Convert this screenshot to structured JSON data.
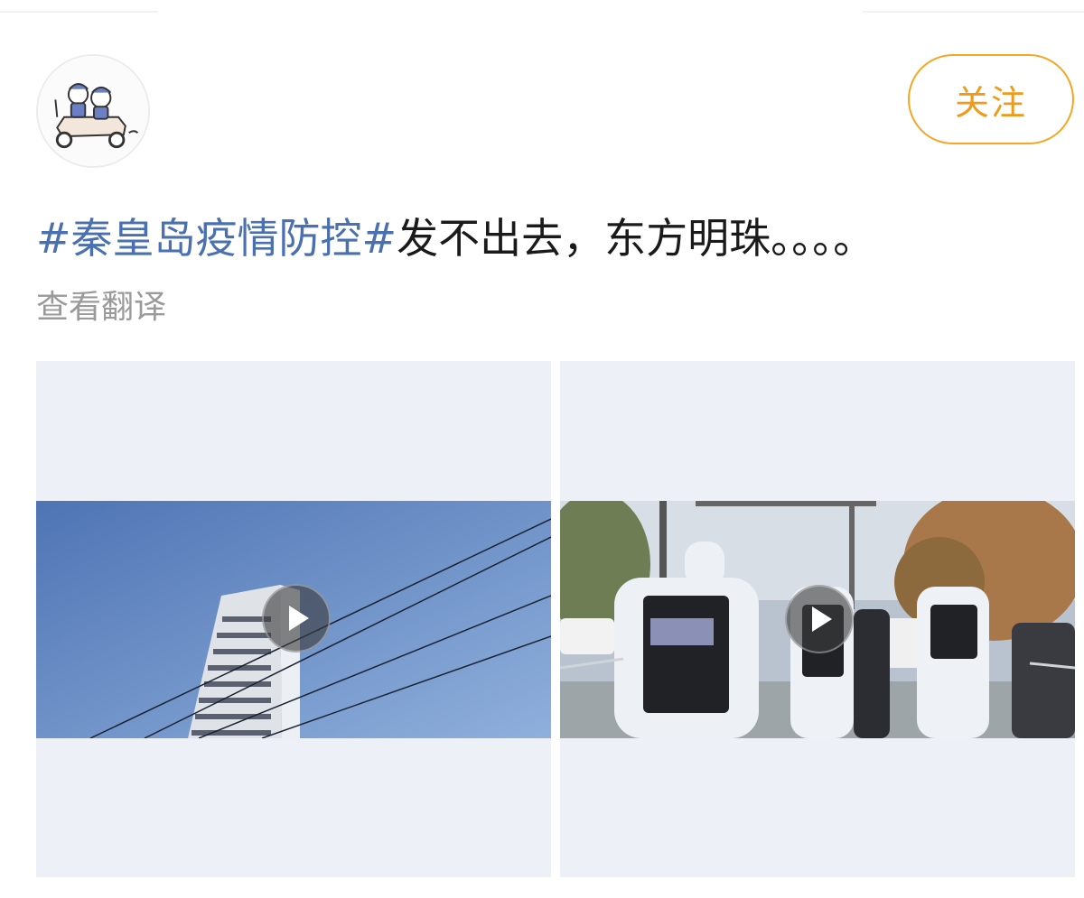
{
  "post": {
    "follow_label": "关注",
    "hashtag": "#秦皇岛疫情防控#",
    "text": "发不出去，东方明珠。。。。",
    "translate_label": "查看翻译"
  },
  "videos": [
    {
      "kind": "video",
      "scene": "high-rise building under blue sky with power lines"
    },
    {
      "kind": "video",
      "scene": "workers in protective suits and vests at a street checkpoint"
    }
  ],
  "colors": {
    "follow_accent": "#f5a623",
    "hashtag": "#4a70b0",
    "text": "#1a1a1a",
    "muted": "#9a9a9a",
    "tile_bg": "#edf0f7"
  }
}
